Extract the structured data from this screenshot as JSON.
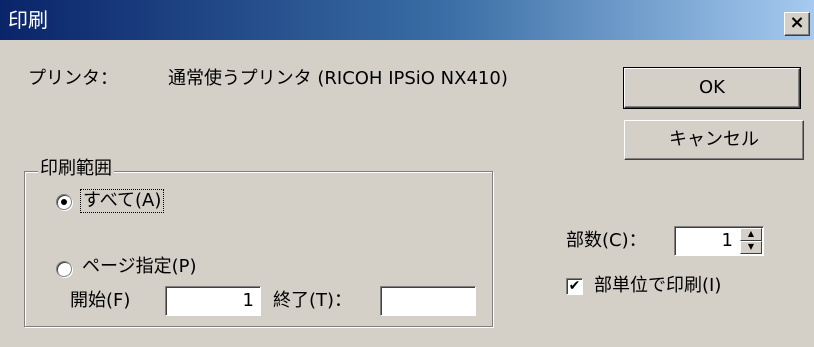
{
  "window": {
    "title": "印刷",
    "close_symbol": "×"
  },
  "printer": {
    "label": "プリンタ：",
    "value": "通常使うプリンタ (RICOH IPSiO NX410)"
  },
  "buttons": {
    "ok": "OK",
    "cancel": "キャンセル"
  },
  "print_range": {
    "legend": "印刷範囲",
    "all_label": "すべて(A)",
    "all_selected": true,
    "pages_label": "ページ指定(P)",
    "pages_selected": false,
    "start_label": "開始(F)",
    "start_value": "1",
    "end_label": "終了(T)：",
    "end_value": ""
  },
  "copies": {
    "label": "部数(C)：",
    "value": "1",
    "collate_label": "部単位で印刷(I)",
    "collate_checked": true,
    "check_mark": "✔"
  },
  "spin_up": "▲",
  "spin_down": "▼"
}
